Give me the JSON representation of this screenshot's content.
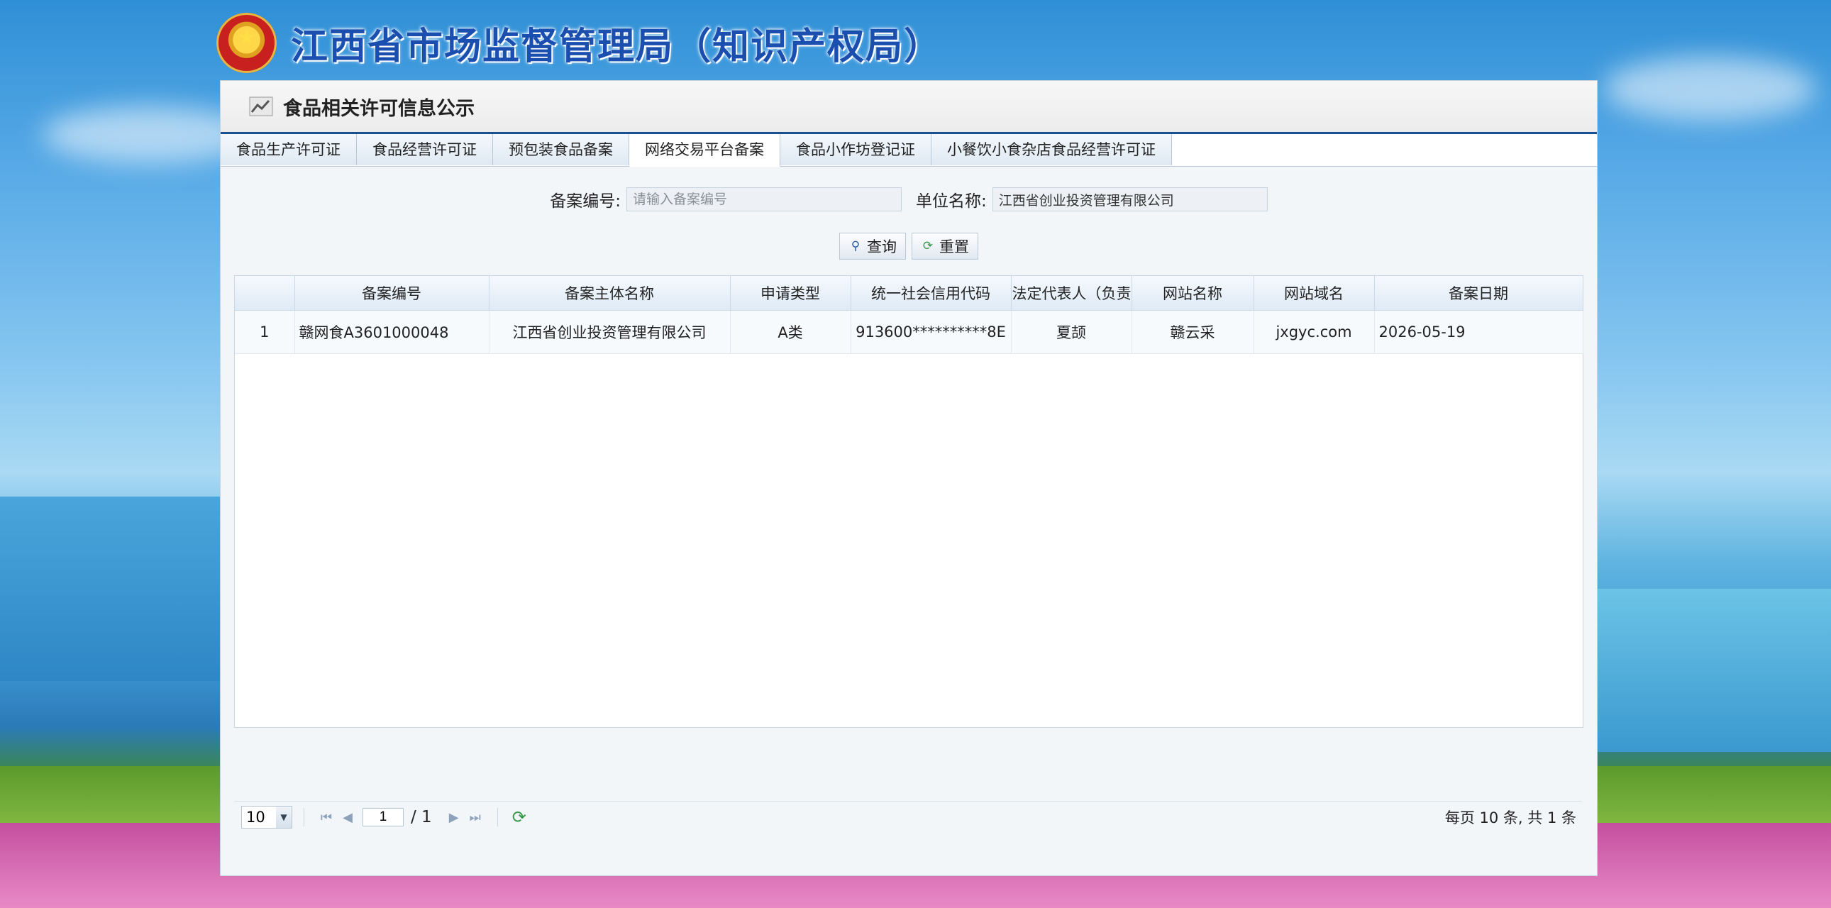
{
  "header": {
    "title": "江西省市场监督管理局（知识产权局）"
  },
  "panel": {
    "title": "食品相关许可信息公示"
  },
  "tabs": [
    {
      "label": "食品生产许可证"
    },
    {
      "label": "食品经营许可证"
    },
    {
      "label": "预包装食品备案"
    },
    {
      "label": "网络交易平台备案",
      "active": true
    },
    {
      "label": "食品小作坊登记证"
    },
    {
      "label": "小餐饮小食杂店食品经营许可证"
    }
  ],
  "search": {
    "record_label": "备案编号:",
    "record_placeholder": "请输入备案编号",
    "record_value": "",
    "unit_label": "单位名称:",
    "unit_value": "江西省创业投资管理有限公司",
    "query_label": "查询",
    "reset_label": "重置"
  },
  "table": {
    "columns": [
      "",
      "备案编号",
      "备案主体名称",
      "申请类型",
      "统一社会信用代码",
      "法定代表人（负责",
      "网站名称",
      "网站域名",
      "备案日期"
    ],
    "rows": [
      [
        "1",
        "赣网食A3601000048",
        "江西省创业投资管理有限公司",
        "A类",
        "913600**********8E",
        "夏颉",
        "赣云采",
        "jxgyc.com",
        "2026-05-19"
      ]
    ]
  },
  "pager": {
    "page_size": "10",
    "current_page": "1",
    "total_pages": "/ 1",
    "info": "每页 10 条, 共 1 条"
  },
  "colors": {
    "title_blue": "#1a4fb0",
    "header_rule": "#1a4f8f"
  }
}
